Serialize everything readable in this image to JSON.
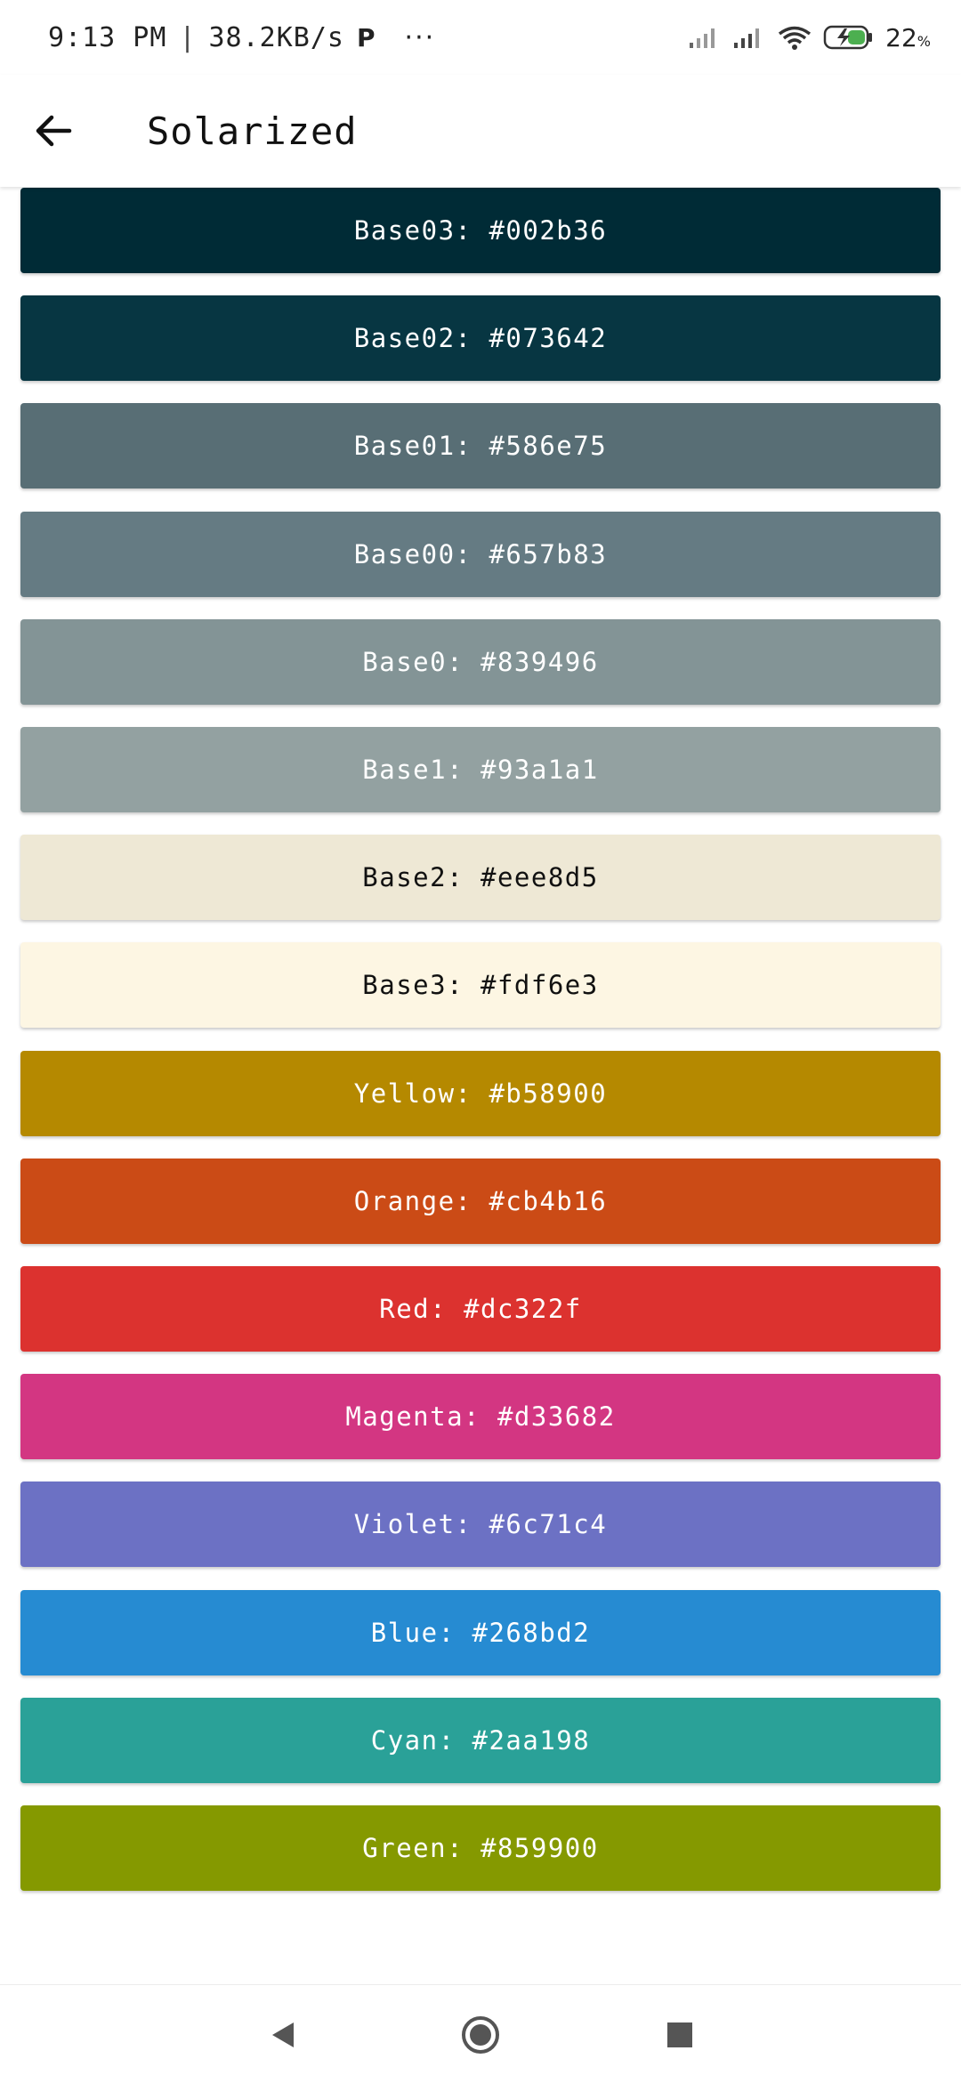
{
  "status_bar": {
    "time": "9:13 PM",
    "separator": "|",
    "speed": "38.2KB/s",
    "p_icon": "P",
    "more": "···",
    "battery_percent": "22",
    "percent_sign": "%"
  },
  "app_bar": {
    "title": "Solarized",
    "back_icon": "arrow-left-icon"
  },
  "colors": [
    {
      "label": "Base03: #002b36",
      "bg": "#002b36",
      "fg": "#ffffff"
    },
    {
      "label": "Base02: #073642",
      "bg": "#073642",
      "fg": "#ffffff"
    },
    {
      "label": "Base01: #586e75",
      "bg": "#586e75",
      "fg": "#ffffff"
    },
    {
      "label": "Base00: #657b83",
      "bg": "#657b83",
      "fg": "#ffffff"
    },
    {
      "label": "Base0: #839496",
      "bg": "#839496",
      "fg": "#ffffff"
    },
    {
      "label": "Base1: #93a1a1",
      "bg": "#93a1a1",
      "fg": "#ffffff"
    },
    {
      "label": "Base2: #eee8d5",
      "bg": "#eee8d5",
      "fg": "#111111"
    },
    {
      "label": "Base3: #fdf6e3",
      "bg": "#fdf6e3",
      "fg": "#111111"
    },
    {
      "label": "Yellow: #b58900",
      "bg": "#b58900",
      "fg": "#ffffff"
    },
    {
      "label": "Orange: #cb4b16",
      "bg": "#cb4b16",
      "fg": "#ffffff"
    },
    {
      "label": "Red: #dc322f",
      "bg": "#dc322f",
      "fg": "#ffffff"
    },
    {
      "label": "Magenta: #d33682",
      "bg": "#d33682",
      "fg": "#ffffff"
    },
    {
      "label": "Violet: #6c71c4",
      "bg": "#6c71c4",
      "fg": "#ffffff"
    },
    {
      "label": "Blue: #268bd2",
      "bg": "#268bd2",
      "fg": "#ffffff"
    },
    {
      "label": "Cyan: #2aa198",
      "bg": "#2aa198",
      "fg": "#ffffff"
    },
    {
      "label": "Green: #859900",
      "bg": "#859900",
      "fg": "#ffffff"
    }
  ],
  "nav_bar": {
    "back": "back-triangle-icon",
    "home": "home-circle-icon",
    "recents": "recents-square-icon"
  }
}
